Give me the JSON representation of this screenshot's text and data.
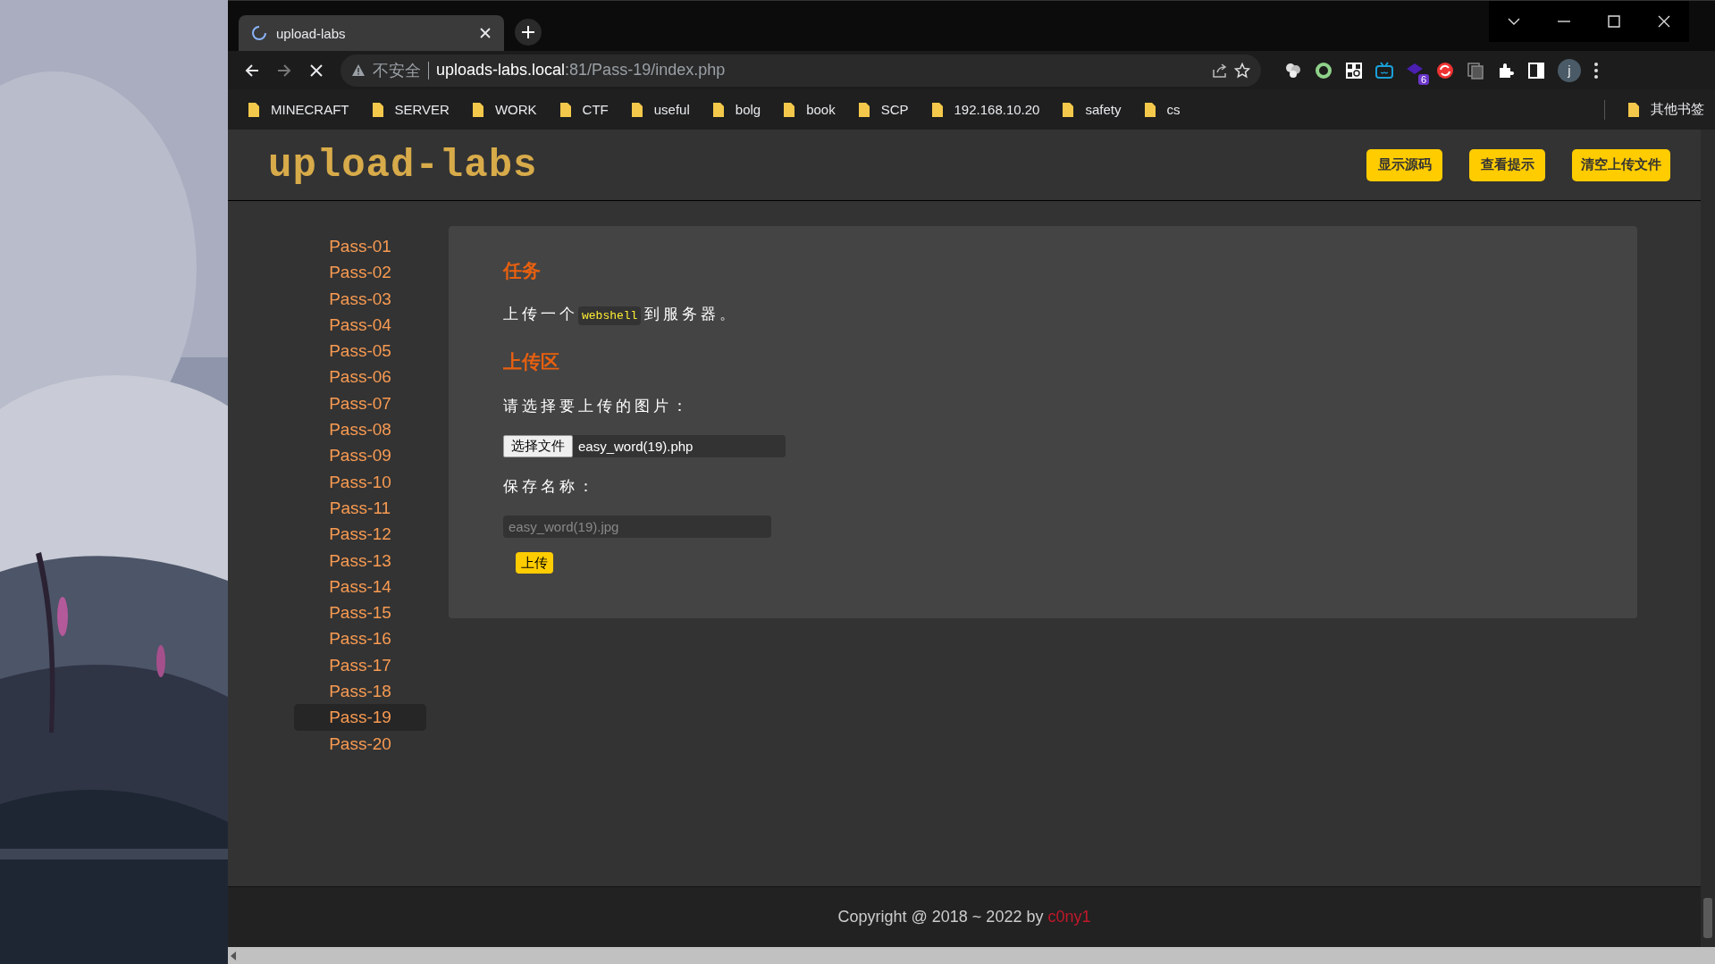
{
  "browser": {
    "tabs": [
      {
        "title": "upload-labs",
        "selected": true,
        "loading": true
      }
    ],
    "address": {
      "security_label": "不安全",
      "host": "uploads-labs.local",
      "path": ":81/Pass-19/index.php"
    },
    "extension_badge": "6",
    "profile_initial": "j",
    "bookmarks": [
      {
        "label": "MINECRAFT"
      },
      {
        "label": "SERVER"
      },
      {
        "label": "WORK"
      },
      {
        "label": "CTF"
      },
      {
        "label": "useful"
      },
      {
        "label": "bolg"
      },
      {
        "label": "book"
      },
      {
        "label": "SCP"
      },
      {
        "label": "192.168.10.20"
      },
      {
        "label": "safety"
      },
      {
        "label": "cs"
      }
    ],
    "other_bookmarks": "其他书签"
  },
  "page": {
    "logo": "upload-labs",
    "header_buttons": [
      "显示源码",
      "查看提示",
      "清空上传文件"
    ],
    "levels": [
      {
        "label": "Pass-01",
        "selected": false
      },
      {
        "label": "Pass-02",
        "selected": false
      },
      {
        "label": "Pass-03",
        "selected": false
      },
      {
        "label": "Pass-04",
        "selected": false
      },
      {
        "label": "Pass-05",
        "selected": false
      },
      {
        "label": "Pass-06",
        "selected": false
      },
      {
        "label": "Pass-07",
        "selected": false
      },
      {
        "label": "Pass-08",
        "selected": false
      },
      {
        "label": "Pass-09",
        "selected": false
      },
      {
        "label": "Pass-10",
        "selected": false
      },
      {
        "label": "Pass-11",
        "selected": false
      },
      {
        "label": "Pass-12",
        "selected": false
      },
      {
        "label": "Pass-13",
        "selected": false
      },
      {
        "label": "Pass-14",
        "selected": false
      },
      {
        "label": "Pass-15",
        "selected": false
      },
      {
        "label": "Pass-16",
        "selected": false
      },
      {
        "label": "Pass-17",
        "selected": false
      },
      {
        "label": "Pass-18",
        "selected": false
      },
      {
        "label": "Pass-19",
        "selected": true
      },
      {
        "label": "Pass-20",
        "selected": false
      }
    ],
    "task": {
      "heading": "任务",
      "text_before": "上传一个",
      "code": "webshell",
      "text_after": "到服务器。"
    },
    "upload": {
      "heading": "上传区",
      "file_label": "请选择要上传的图片：",
      "choose_button": "选择文件",
      "file_name": "easy_word(19).php",
      "save_label": "保存名称：",
      "save_placeholder": "easy_word(19).jpg",
      "submit": "上传"
    },
    "footer": {
      "text": "Copyright @ 2018 ~ 2022 by",
      "author": "c0ny1"
    }
  }
}
